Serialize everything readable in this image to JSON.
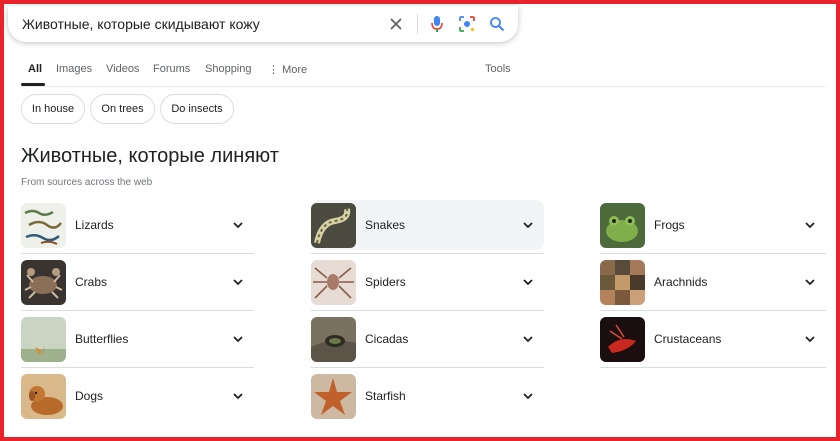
{
  "search": {
    "query": "Животные, которые скидывают кожу"
  },
  "tabs": [
    {
      "label": "All"
    },
    {
      "label": "Images"
    },
    {
      "label": "Videos"
    },
    {
      "label": "Forums"
    },
    {
      "label": "Shopping"
    },
    {
      "label": "More"
    }
  ],
  "tools_label": "Tools",
  "chips": [
    {
      "label": "In house"
    },
    {
      "label": "On trees"
    },
    {
      "label": "Do insects"
    }
  ],
  "section": {
    "title": "Животные, которые линяют",
    "subtitle": "From sources across the web"
  },
  "columns": [
    [
      {
        "label": "Lizards",
        "icon": "lizard-thumbnail"
      },
      {
        "label": "Crabs",
        "icon": "crab-thumbnail"
      },
      {
        "label": "Butterflies",
        "icon": "butterfly-thumbnail"
      },
      {
        "label": "Dogs",
        "icon": "dog-thumbnail"
      }
    ],
    [
      {
        "label": "Snakes",
        "icon": "snake-thumbnail"
      },
      {
        "label": "Spiders",
        "icon": "spider-thumbnail"
      },
      {
        "label": "Cicadas",
        "icon": "cicada-thumbnail"
      },
      {
        "label": "Starfish",
        "icon": "starfish-thumbnail"
      }
    ],
    [
      {
        "label": "Frogs",
        "icon": "frog-thumbnail"
      },
      {
        "label": "Arachnids",
        "icon": "arachnid-thumbnail"
      },
      {
        "label": "Crustaceans",
        "icon": "crustacean-thumbnail"
      }
    ]
  ],
  "colors": {
    "frame": "#e8232b",
    "text": "#202124",
    "muted": "#5f6368",
    "divider": "#dadce0",
    "hover": "#f3f4f6"
  }
}
